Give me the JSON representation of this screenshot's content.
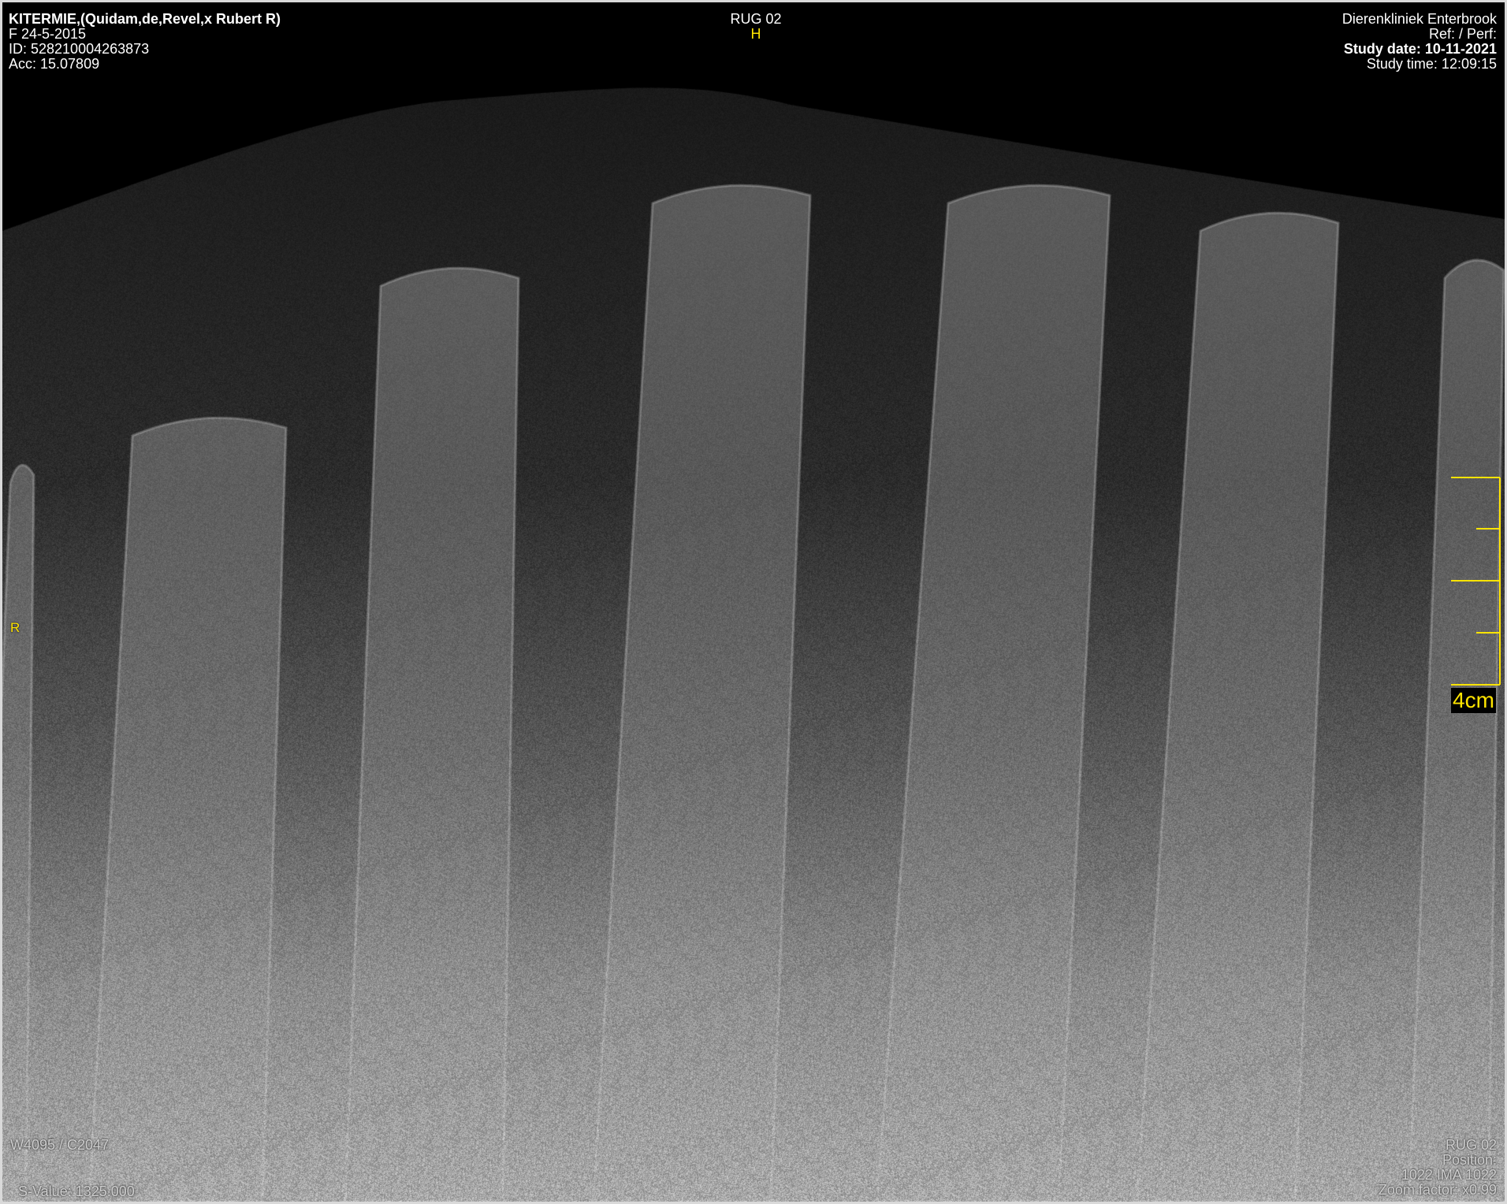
{
  "patient": {
    "name": "KITERMIE,(Quidam,de,Revel,x Rubert R)",
    "sex_dob": "F  24-5-2015",
    "id": "ID: 528210004263873",
    "acc": "Acc: 15.07809"
  },
  "series": {
    "title": "RUG 02",
    "orientation_top": "H",
    "orientation_left": "R"
  },
  "clinic": {
    "name": "Dierenkliniek Enterbrook",
    "ref": "Ref:  / Perf:",
    "study_date": "Study date: 10-11-2021",
    "study_time": "Study time: 12:09:15"
  },
  "window": {
    "wl": "W4095 / C2047",
    "s_value": "S-Value: 1325.000"
  },
  "image_info": {
    "series_name": "RUG 02",
    "position": "Position:",
    "image_index": "1022 IMA 1022",
    "zoom": "Zoom factor: x0.99"
  },
  "scale": {
    "label": "4cm",
    "color": "#ffe400"
  },
  "image": {
    "description": "Lateral radiograph of dorsal spinous processes"
  },
  "colors": {
    "overlay_text": "#ffffff",
    "overlay_accent": "#ffe400",
    "frame": "#d9d9d9"
  }
}
